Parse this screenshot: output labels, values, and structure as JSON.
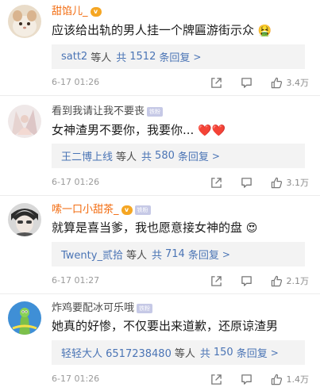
{
  "comments": [
    {
      "username": "甜馅儿_",
      "has_vip": true,
      "has_fan_badge": false,
      "text": "应该给出轨的男人挂一个牌匾游街示众",
      "text_emoji": "🤮",
      "replies": {
        "users": "satt2",
        "who_label": "等人",
        "total_prefix": "共",
        "count": "1512",
        "suffix": "条回复"
      },
      "time": "6-17 01:26",
      "likes": "3.4万"
    },
    {
      "username": "看到我请让我不要丧",
      "has_vip": false,
      "has_fan_badge": true,
      "fan_badge": "铁粉",
      "text": "女神渣男不要你，我要你...",
      "text_emoji": "❤️❤️",
      "replies": {
        "users": "王二博上线",
        "who_label": "等人",
        "total_prefix": "共",
        "count": "580",
        "suffix": "条回复"
      },
      "time": "6-17 01:26",
      "likes": "3.1万"
    },
    {
      "username": "嗦一口小甜茶_",
      "has_vip": true,
      "has_fan_badge": true,
      "fan_badge": "铁粉",
      "text": "就算是喜当爹，我也愿意接女神的盘",
      "text_emoji": "😍",
      "replies": {
        "users": "Twenty_贰拾",
        "who_label": "等人",
        "total_prefix": "共",
        "count": "714",
        "suffix": "条回复"
      },
      "time": "6-17 01:27",
      "likes": "2.1万"
    },
    {
      "username": "炸鸡要配冰可乐哦",
      "has_vip": false,
      "has_fan_badge": true,
      "fan_badge": "铁粉",
      "text": "她真的好惨，不仅要出来道歉，还原谅渣男",
      "text_emoji": "",
      "replies": {
        "users": "轻轻大人 6517238480",
        "who_label": "等人",
        "total_prefix": "共",
        "count": "150",
        "suffix": "条回复"
      },
      "time": "6-17 01:26",
      "likes": "1.4万"
    }
  ],
  "colors": {
    "vip_name": "#f26b0f",
    "plain_name": "#4a4a4a",
    "reply_link": "#4a74b5",
    "reply_bg": "#f3f3f3",
    "meta_text": "#9a9a9a"
  },
  "icons": {
    "share": "share-icon",
    "comment": "comment-icon",
    "like": "thumbs-up-icon",
    "reply_more": "chevron-right-icon"
  }
}
